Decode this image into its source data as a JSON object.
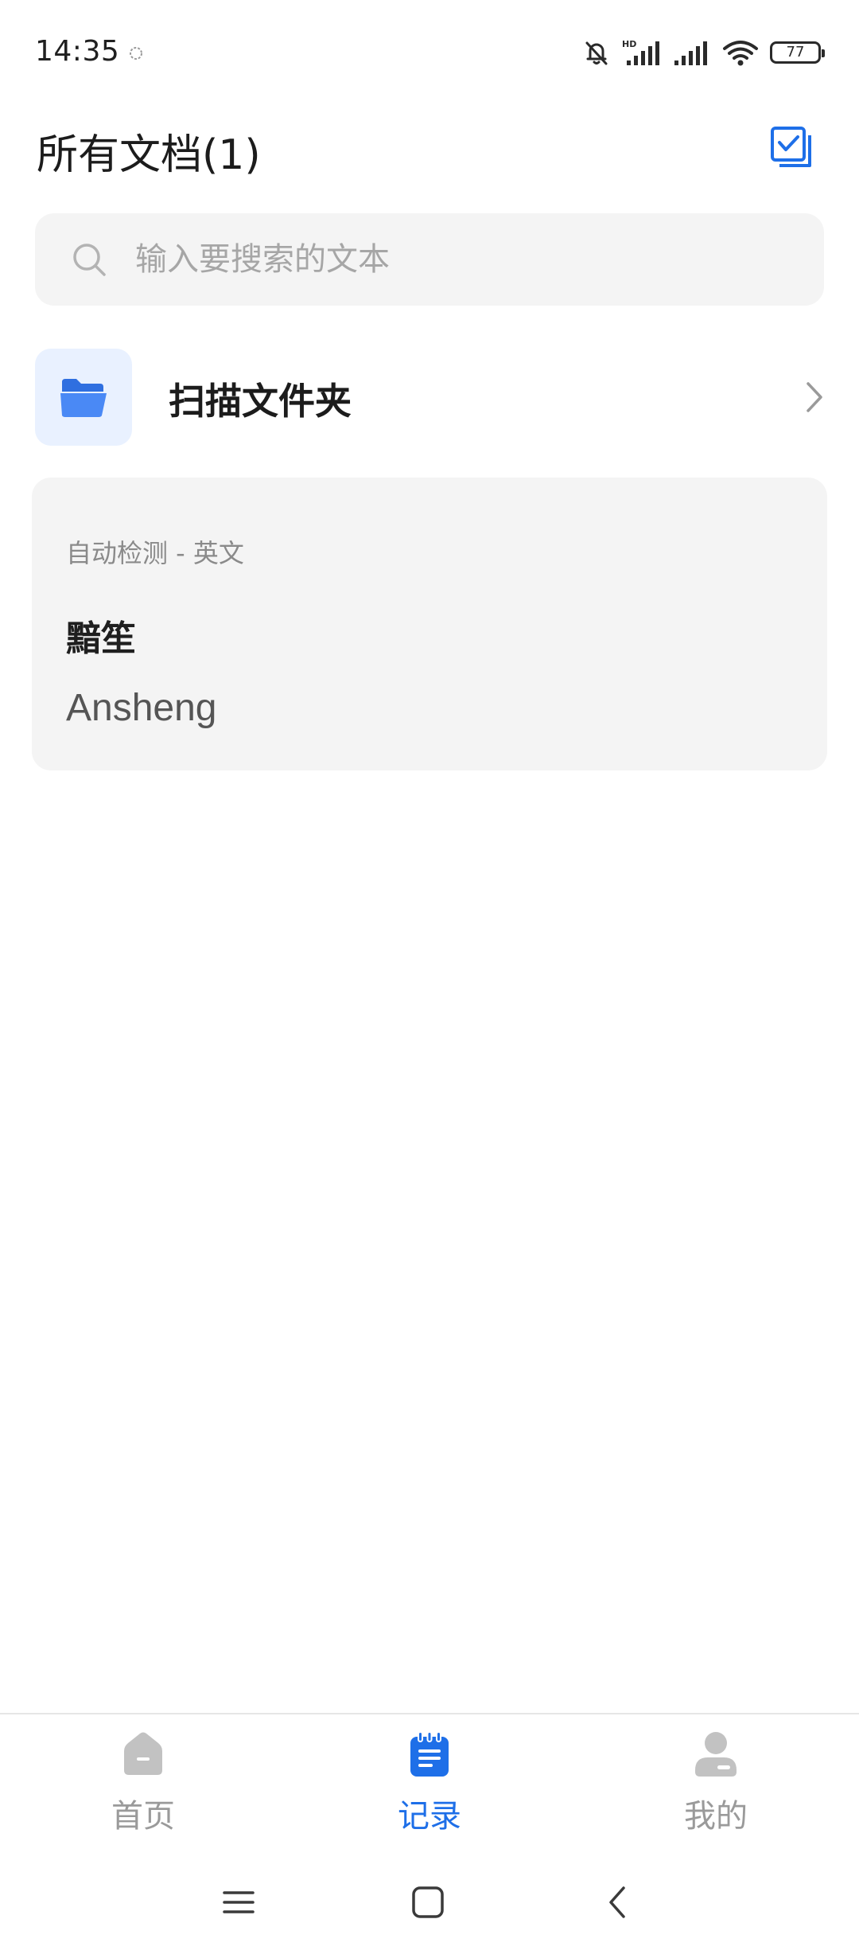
{
  "status_bar": {
    "time": "14:35",
    "battery": "77",
    "icons": [
      "mute-bell-icon",
      "hd-signal-icon",
      "signal-icon",
      "wifi-icon",
      "battery-icon"
    ]
  },
  "header": {
    "title": "所有文档(1)",
    "action_icon": "multi-select-icon"
  },
  "search": {
    "placeholder": "输入要搜索的文本",
    "value": ""
  },
  "folder": {
    "label": "扫描文件夹",
    "icon": "folder-icon"
  },
  "documents": [
    {
      "meta": "自动检测 - 英文",
      "title": "黯笙",
      "text": "Ansheng"
    }
  ],
  "bottom_nav": {
    "items": [
      {
        "label": "首页",
        "icon": "home-icon",
        "active": false
      },
      {
        "label": "记录",
        "icon": "records-icon",
        "active": true
      },
      {
        "label": "我的",
        "icon": "profile-icon",
        "active": false
      }
    ]
  },
  "colors": {
    "accent": "#1e6fe8",
    "inactive": "#9a9a9a",
    "card_bg": "#f4f4f4",
    "folder_bg": "#e9f1ff"
  }
}
